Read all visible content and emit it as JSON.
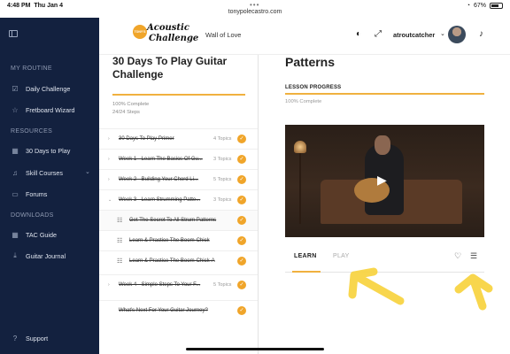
{
  "status": {
    "time": "4:48 PM",
    "date": "Thu Jan 4",
    "url": "tonypolecastro.com",
    "battery": "67%"
  },
  "sidebar": {
    "sections": [
      {
        "label": "MY ROUTINE"
      },
      {
        "label": "RESOURCES"
      },
      {
        "label": "DOWNLOADS"
      }
    ],
    "items": [
      {
        "label": "Daily Challenge",
        "icon": "check-square-icon"
      },
      {
        "label": "Fretboard Wizard",
        "icon": "star-icon"
      },
      {
        "label": "30 Days to Play",
        "icon": "calendar-icon"
      },
      {
        "label": "Skill Courses",
        "icon": "guitar-icon"
      },
      {
        "label": "Forums",
        "icon": "chat-icon"
      },
      {
        "label": "TAC Guide",
        "icon": "calendar-icon"
      },
      {
        "label": "Guitar Journal",
        "icon": "download-icon"
      },
      {
        "label": "Support",
        "icon": "help-icon"
      }
    ]
  },
  "header": {
    "logo_line1": "Acoustic",
    "logo_line2": "Challenge",
    "logo_badge": "TONY'S",
    "wall_of_love": "Wall of Love",
    "username": "atroutcatcher"
  },
  "course": {
    "title": "30 Days To Play Guitar Challenge",
    "percent_complete": "100% Complete",
    "steps": "24/24 Steps",
    "rows": [
      {
        "label": "30 Days To Play Primer",
        "topics": "4 Topics",
        "type": "module"
      },
      {
        "label": "Week 1 - Learn The Basics Of Gu...",
        "topics": "3 Topics",
        "type": "module"
      },
      {
        "label": "Week 2 - Building Your Chord Li...",
        "topics": "5 Topics",
        "type": "module"
      },
      {
        "label": "Week 3 - Learn Strumming Patte...",
        "topics": "3 Topics",
        "type": "module-open"
      },
      {
        "label": "Get The Secret To All Strum Patterns",
        "topics": "",
        "type": "lesson"
      },
      {
        "label": "Learn & Practice The Boom-Chick",
        "topics": "",
        "type": "lesson"
      },
      {
        "label": "Learn & Practice The Boom-Chick-A",
        "topics": "",
        "type": "lesson"
      },
      {
        "label": "Week 4 - Simple Steps To Your F...",
        "topics": "5 Topics",
        "type": "module"
      },
      {
        "label": "What's Next For Your Guitar Journey?",
        "topics": "",
        "type": "final"
      }
    ]
  },
  "main": {
    "title": "Patterns",
    "lesson_progress_label": "LESSON PROGRESS",
    "lesson_progress_pct": "100% Complete",
    "tabs": [
      "LEARN",
      "PLAY"
    ]
  },
  "colors": {
    "sidebar_bg": "#13213f",
    "accent": "#f0a52a",
    "annotation": "#f7d23e"
  }
}
